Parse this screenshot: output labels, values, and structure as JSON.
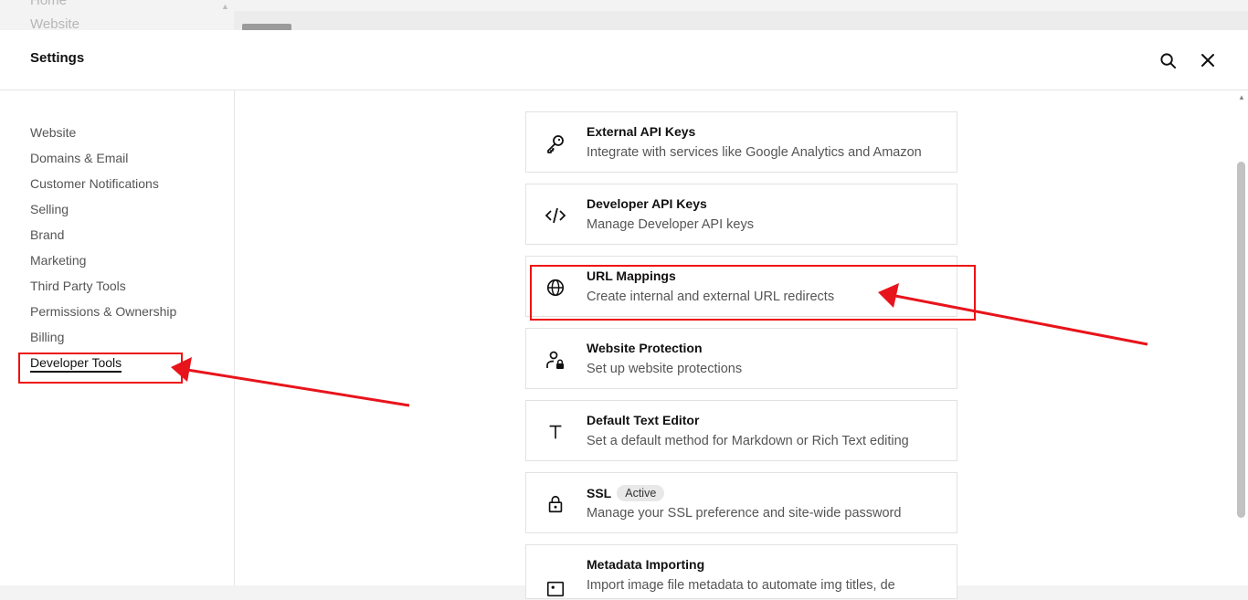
{
  "background": {
    "nav_items": [
      "Home",
      "Website"
    ]
  },
  "header": {
    "title": "Settings"
  },
  "sidebar": {
    "items": [
      {
        "label": "Website"
      },
      {
        "label": "Domains & Email"
      },
      {
        "label": "Customer Notifications"
      },
      {
        "label": "Selling"
      },
      {
        "label": "Brand"
      },
      {
        "label": "Marketing"
      },
      {
        "label": "Third Party Tools"
      },
      {
        "label": "Permissions & Ownership"
      },
      {
        "label": "Billing"
      },
      {
        "label": "Developer Tools",
        "active": true
      }
    ]
  },
  "cards": [
    {
      "icon": "key-icon",
      "title": "External API Keys",
      "description": "Integrate with services like Google Analytics and Amazon"
    },
    {
      "icon": "code-icon",
      "title": "Developer API Keys",
      "description": "Manage Developer API keys"
    },
    {
      "icon": "globe-icon",
      "title": "URL Mappings",
      "description": "Create internal and external URL redirects"
    },
    {
      "icon": "user-lock-icon",
      "title": "Website Protection",
      "description": "Set up website protections"
    },
    {
      "icon": "text-icon",
      "title": "Default Text Editor",
      "description": "Set a default method for Markdown or Rich Text editing"
    },
    {
      "icon": "lock-icon",
      "title": "SSL",
      "badge": "Active",
      "description": "Manage your SSL preference and site-wide password"
    },
    {
      "icon": "image-icon",
      "title": "Metadata Importing",
      "description": "Import image file metadata to automate img titles, de"
    }
  ],
  "annotation_color": "#e8141b"
}
